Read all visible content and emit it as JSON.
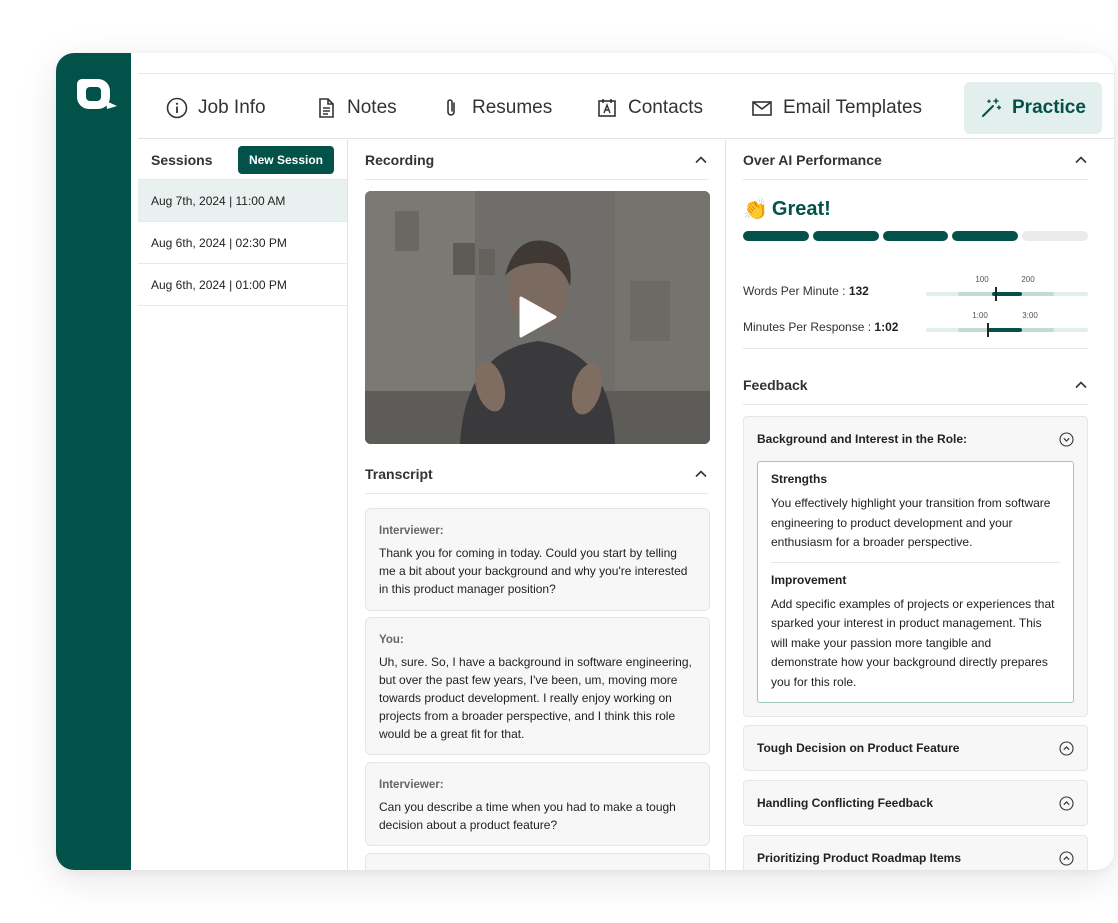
{
  "nav": {
    "tabs": [
      {
        "label": "Job Info",
        "icon": "info-icon"
      },
      {
        "label": "Notes",
        "icon": "document-icon"
      },
      {
        "label": "Resumes",
        "icon": "paperclip-icon"
      },
      {
        "label": "Contacts",
        "icon": "contact-card-icon"
      },
      {
        "label": "Email Templates",
        "icon": "envelope-icon"
      },
      {
        "label": "Practice",
        "icon": "magic-wand-icon",
        "active": true
      }
    ]
  },
  "sessions": {
    "title": "Sessions",
    "new_button": "New Session",
    "items": [
      {
        "label": "Aug 7th, 2024 | 11:00 AM",
        "active": true
      },
      {
        "label": "Aug 6th, 2024 | 02:30 PM"
      },
      {
        "label": "Aug 6th, 2024 | 01:00 PM"
      }
    ]
  },
  "recording": {
    "title": "Recording"
  },
  "transcript": {
    "title": "Transcript",
    "entries": [
      {
        "speaker": "Interviewer:",
        "text": "Thank you for coming in today. Could you start by telling me a bit about your background and why you're interested in this product manager position?"
      },
      {
        "speaker": "You:",
        "text": "Uh, sure. So, I have a background in software engineering, but over the past few years, I've been, um, moving more towards product development. I really enjoy working on projects from a broader perspective, and I think this role would be a great fit for that."
      },
      {
        "speaker": "Interviewer:",
        "text": "Can you describe a time when you had to make a tough decision about a product feature?"
      }
    ]
  },
  "performance": {
    "title": "Over AI Performance",
    "rating": "Great!",
    "rating_emoji": "👏",
    "rating_segments_filled": 4,
    "rating_segments_total": 5,
    "metrics": [
      {
        "label": "Words Per Minute : ",
        "value": "132",
        "ticks": [
          "100",
          "200"
        ]
      },
      {
        "label": "Minutes Per Response : ",
        "value": "1:02",
        "ticks": [
          "1:00",
          "3:00"
        ]
      }
    ]
  },
  "feedback": {
    "title": "Feedback",
    "items": [
      {
        "title": "Background and Interest in the Role:",
        "expanded": true,
        "strengths_label": "Strengths",
        "strengths": "You effectively highlight your transition from software engineering to product development and your enthusiasm for a broader perspective.",
        "improvement_label": "Improvement",
        "improvement": "Add specific examples of projects or experiences that sparked your interest in product management. This will make your passion more tangible and demonstrate how your background directly prepares you for this role."
      },
      {
        "title": "Tough Decision on Product Feature"
      },
      {
        "title": "Handling Conflicting Feedback"
      },
      {
        "title": "Prioritizing Product Roadmap Items"
      }
    ]
  },
  "colors": {
    "brand": "#03524a",
    "active_tab_bg": "#e3efec"
  }
}
